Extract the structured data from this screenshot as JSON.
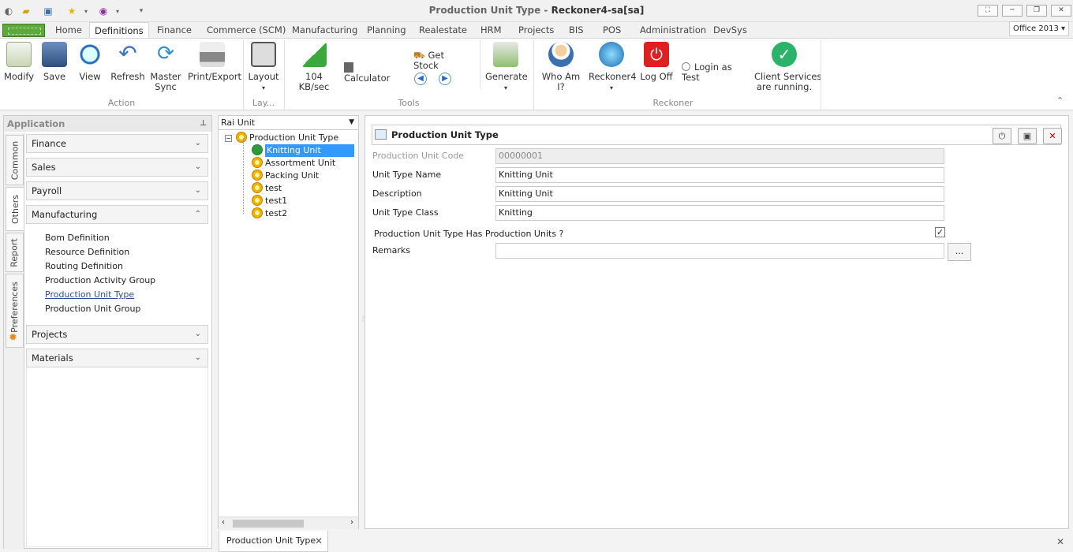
{
  "window": {
    "title_main": "Production Unit Type - ",
    "title_bold": "Reckoner4-sa[sa]"
  },
  "tabs": [
    "Home",
    "Definitions",
    "Finance",
    "Commerce (SCM)",
    "Manufacturing",
    "Planning",
    "Realestate",
    "HRM",
    "Projects",
    "BIS",
    "POS",
    "Administration",
    "DevSys"
  ],
  "theme_select": "Office 2013",
  "ribbon": {
    "action": {
      "label": "Action",
      "buttons": [
        "Modify",
        "Save",
        "View",
        "Refresh",
        "Master\nSync",
        "Print/Export"
      ]
    },
    "layout": {
      "label": "Lay...",
      "button": "Layout"
    },
    "tools": {
      "label": "Tools",
      "speed": "104 KB/sec",
      "calculator": "Calculator",
      "get_stock": "Get Stock",
      "generate": "Generate"
    },
    "reckoner": {
      "label": "Reckoner",
      "who": "Who Am I?",
      "reckoner4": "Reckoner4",
      "logoff": "Log Off",
      "login_test": "Login as Test",
      "client_services": "Client Services\nare running."
    }
  },
  "sidebar": {
    "header": "Application",
    "vtabs": [
      "Common",
      "Others",
      "Report",
      "Preferences"
    ],
    "groups": [
      "Finance",
      "Sales",
      "Payroll",
      "Manufacturing",
      "Projects",
      "Materials"
    ],
    "manufacturing_items": [
      "Bom Definition",
      "Resource Definition",
      "Routing Definition",
      "Production Activity Group",
      "Production Unit Type",
      "Production Unit Group"
    ]
  },
  "tree": {
    "combo": "Rai Unit",
    "root": "Production Unit Type",
    "children": [
      "Knitting Unit",
      "Assortment Unit",
      "Packing Unit",
      "test",
      "test1",
      "test2"
    ]
  },
  "form": {
    "title": "Production Unit Type",
    "fields": {
      "code_label": "Production Unit Code",
      "code_value": "00000001",
      "name_label": "Unit Type Name",
      "name_value": "Knitting Unit",
      "desc_label": "Description",
      "desc_value": "Knitting Unit",
      "class_label": "Unit Type Class",
      "class_value": "Knitting",
      "has_units_label": "Production Unit Type Has Production Units ?",
      "has_units_checked": true,
      "remarks_label": "Remarks",
      "remarks_value": ""
    },
    "ellipsis": "..."
  },
  "doc_tab": "Production Unit Type"
}
